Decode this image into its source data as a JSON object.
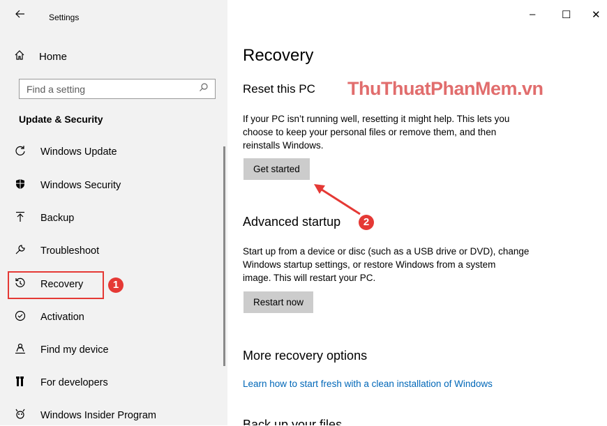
{
  "window": {
    "title": "Settings",
    "back_icon": "back-arrow-icon",
    "minimize": "–",
    "maximize": "☐",
    "close": "✕"
  },
  "sidebar": {
    "home_label": "Home",
    "search_placeholder": "Find a setting",
    "section_label": "Update & Security",
    "items": [
      {
        "label": "Windows Update",
        "icon": "refresh-icon"
      },
      {
        "label": "Windows Security",
        "icon": "shield-icon"
      },
      {
        "label": "Backup",
        "icon": "upload-icon"
      },
      {
        "label": "Troubleshoot",
        "icon": "wrench-icon"
      },
      {
        "label": "Recovery",
        "icon": "history-icon"
      },
      {
        "label": "Activation",
        "icon": "check-circle-icon"
      },
      {
        "label": "Find my device",
        "icon": "person-location-icon"
      },
      {
        "label": "For developers",
        "icon": "developer-icon"
      },
      {
        "label": "Windows Insider Program",
        "icon": "insider-icon"
      }
    ],
    "selected": "Recovery"
  },
  "main": {
    "title": "Recovery",
    "reset_heading": "Reset this PC",
    "watermark": "ThuThuatPhanMem.vn",
    "reset_text_1": "If your PC isn’t running well, resetting it might help. This lets you",
    "reset_text_2": "choose to keep your personal files or remove them, and then",
    "reset_text_3": "reinstalls Windows.",
    "get_started_label": "Get started",
    "advanced_heading": "Advanced startup",
    "advanced_text_1": "Start up from a device or disc (such as a USB drive or DVD), change",
    "advanced_text_2": "Windows startup settings, or restore Windows from a system",
    "advanced_text_3": "image. This will restart your PC.",
    "restart_label": "Restart now",
    "more_heading": "More recovery options",
    "fresh_link": "Learn how to start fresh with a clean installation of Windows",
    "backup_heading": "Back up your files"
  },
  "annotations": {
    "badge_1": "1",
    "badge_2": "2",
    "color": "#e53935"
  }
}
